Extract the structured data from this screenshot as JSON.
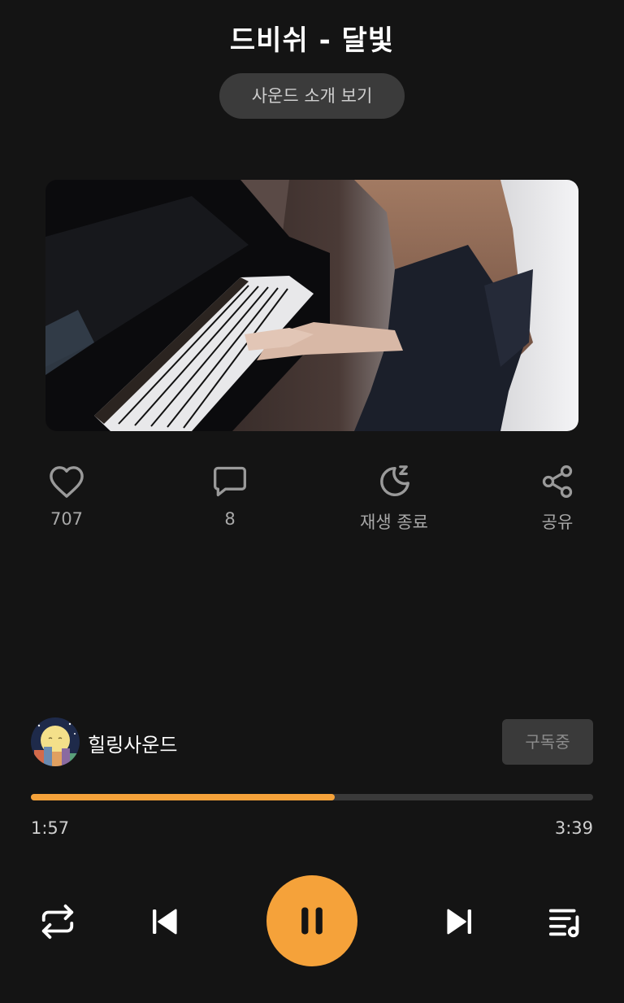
{
  "track": {
    "title": "드비쉬 - 달빛",
    "intro_button": "사운드 소개 보기"
  },
  "actions": {
    "like_count": "707",
    "comment_count": "8",
    "sleep_label": "재생 종료",
    "share_label": "공유"
  },
  "channel": {
    "name": "힐링사운드",
    "subscribe_label": "구독중"
  },
  "player": {
    "elapsed": "1:57",
    "duration": "3:39",
    "progress_fraction": 0.54,
    "state": "playing"
  },
  "icons": {
    "like": "heart-outline",
    "comment": "speech-bubble",
    "sleep": "moon-zz",
    "share": "share-nodes",
    "repeat": "repeat-arrows",
    "previous": "skip-previous",
    "pause": "pause",
    "next": "skip-next",
    "playlist": "playlist-music"
  },
  "colors": {
    "background": "#141414",
    "accent": "#f5a23a",
    "icon": "#9a9a9a"
  }
}
